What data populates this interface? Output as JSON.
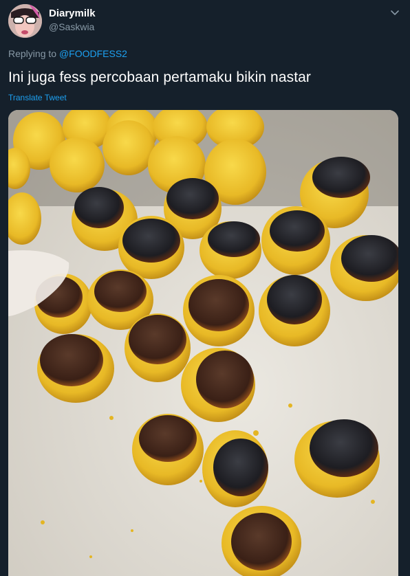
{
  "user": {
    "display_name": "Diarymilk",
    "handle": "@Saskwia"
  },
  "reply": {
    "prefix": "Replying to",
    "mention": "@FOODFESS2"
  },
  "tweet": {
    "text": "Ini juga fess percobaan pertamaku bikin nastar",
    "translate_label": "Translate Tweet"
  },
  "icons": {
    "menu": "chevron-down-icon"
  },
  "colors": {
    "background": "#15202b",
    "link": "#1da1f2",
    "muted": "#8899a6"
  }
}
